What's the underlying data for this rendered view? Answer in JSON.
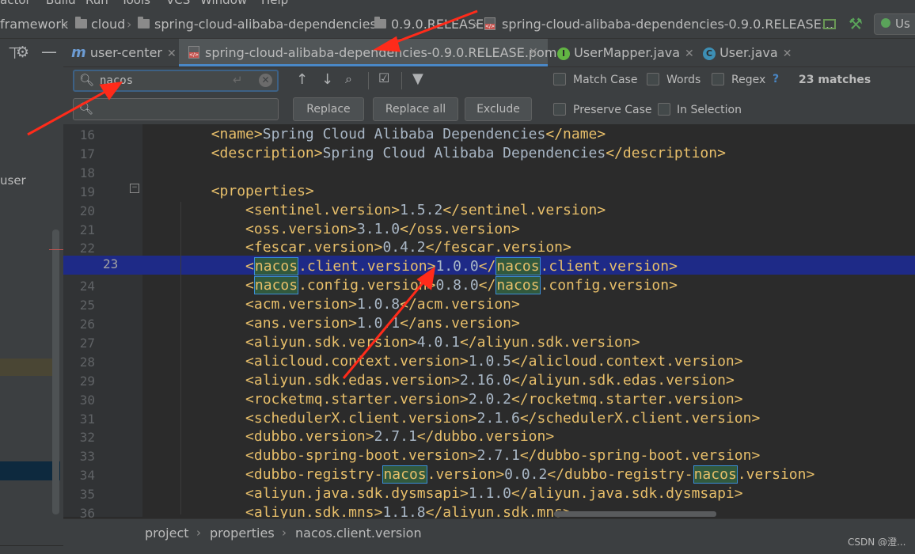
{
  "menubar": {
    "items": [
      "actor",
      "Build",
      "Run",
      "Tools",
      "VCS",
      "Window",
      "Help"
    ]
  },
  "navbar": {
    "crumbs": [
      "framework",
      "cloud",
      "spring-cloud-alibaba-dependencies",
      "0.9.0.RELEASE",
      "spring-cloud-alibaba-dependencies-0.9.0.RELEASE..."
    ],
    "user_button": "Us"
  },
  "left_panel": {
    "item": "user"
  },
  "tabs": [
    {
      "label": "user-center",
      "icon": "m"
    },
    {
      "label": "spring-cloud-alibaba-dependencies-0.9.0.RELEASE.pom",
      "icon": "pom"
    },
    {
      "label": "UserMapper.java",
      "icon": "I"
    },
    {
      "label": "User.java",
      "icon": "C"
    }
  ],
  "find": {
    "search_value": "nacos",
    "replace_value": "",
    "replace_button": "Replace",
    "replace_all_button": "Replace all",
    "exclude_button": "Exclude",
    "match_case": "Match Case",
    "words": "Words",
    "regex": "Regex",
    "help": "?",
    "matches": "23 matches",
    "preserve_case": "Preserve Case",
    "in_selection": "In Selection"
  },
  "code": {
    "lines": [
      {
        "num": "16",
        "indent": "        ",
        "parts": [
          [
            "t",
            "<name>"
          ],
          [
            "x",
            "Spring Cloud Alibaba Dependencies"
          ],
          [
            "t",
            "</name>"
          ]
        ]
      },
      {
        "num": "17",
        "indent": "        ",
        "parts": [
          [
            "t",
            "<description>"
          ],
          [
            "x",
            "Spring Cloud Alibaba Dependencies"
          ],
          [
            "t",
            "</description>"
          ]
        ]
      },
      {
        "num": "18",
        "indent": "",
        "parts": []
      },
      {
        "num": "19",
        "indent": "        ",
        "parts": [
          [
            "t",
            "<properties>"
          ]
        ]
      },
      {
        "num": "20",
        "indent": "            ",
        "parts": [
          [
            "t",
            "<sentinel.version>"
          ],
          [
            "x",
            "1.5.2"
          ],
          [
            "t",
            "</sentinel.version>"
          ]
        ]
      },
      {
        "num": "21",
        "indent": "            ",
        "parts": [
          [
            "t",
            "<oss.version>"
          ],
          [
            "x",
            "3.1.0"
          ],
          [
            "t",
            "</oss.version>"
          ]
        ]
      },
      {
        "num": "22",
        "indent": "            ",
        "parts": [
          [
            "t",
            "<fescar.version>"
          ],
          [
            "x",
            "0.4.2"
          ],
          [
            "t",
            "</fescar.version>"
          ]
        ]
      },
      {
        "num": "23",
        "indent": "            ",
        "parts": [
          [
            "t",
            "<"
          ],
          [
            "h",
            "nacos"
          ],
          [
            "t",
            ".client.version>"
          ],
          [
            "x",
            "1.0.0"
          ],
          [
            "t",
            "</"
          ],
          [
            "h",
            "nacos"
          ],
          [
            "t",
            ".client.version>"
          ]
        ]
      },
      {
        "num": "24",
        "indent": "            ",
        "parts": [
          [
            "t",
            "<"
          ],
          [
            "h",
            "nacos"
          ],
          [
            "t",
            ".config.version>"
          ],
          [
            "x",
            "0.8.0"
          ],
          [
            "t",
            "</"
          ],
          [
            "h",
            "nacos"
          ],
          [
            "t",
            ".config.version>"
          ]
        ]
      },
      {
        "num": "25",
        "indent": "            ",
        "parts": [
          [
            "t",
            "<acm.version>"
          ],
          [
            "x",
            "1.0.8"
          ],
          [
            "t",
            "</acm.version>"
          ]
        ]
      },
      {
        "num": "26",
        "indent": "            ",
        "parts": [
          [
            "t",
            "<ans.version>"
          ],
          [
            "x",
            "1.0.1"
          ],
          [
            "t",
            "</ans.version>"
          ]
        ]
      },
      {
        "num": "27",
        "indent": "            ",
        "parts": [
          [
            "t",
            "<aliyun.sdk.version>"
          ],
          [
            "x",
            "4.0.1"
          ],
          [
            "t",
            "</aliyun.sdk.version>"
          ]
        ]
      },
      {
        "num": "28",
        "indent": "            ",
        "parts": [
          [
            "t",
            "<alicloud.context.version>"
          ],
          [
            "x",
            "1.0.5"
          ],
          [
            "t",
            "</alicloud.context.version>"
          ]
        ]
      },
      {
        "num": "29",
        "indent": "            ",
        "parts": [
          [
            "t",
            "<aliyun.sdk.edas.version>"
          ],
          [
            "x",
            "2.16.0"
          ],
          [
            "t",
            "</aliyun.sdk.edas.version>"
          ]
        ]
      },
      {
        "num": "30",
        "indent": "            ",
        "parts": [
          [
            "t",
            "<rocketmq.starter.version>"
          ],
          [
            "x",
            "2.0.2"
          ],
          [
            "t",
            "</rocketmq.starter.version>"
          ]
        ]
      },
      {
        "num": "31",
        "indent": "            ",
        "parts": [
          [
            "t",
            "<schedulerX.client.version>"
          ],
          [
            "x",
            "2.1.6"
          ],
          [
            "t",
            "</schedulerX.client.version>"
          ]
        ]
      },
      {
        "num": "32",
        "indent": "            ",
        "parts": [
          [
            "t",
            "<dubbo.version>"
          ],
          [
            "x",
            "2.7.1"
          ],
          [
            "t",
            "</dubbo.version>"
          ]
        ]
      },
      {
        "num": "33",
        "indent": "            ",
        "parts": [
          [
            "t",
            "<dubbo-spring-boot.version>"
          ],
          [
            "x",
            "2.7.1"
          ],
          [
            "t",
            "</dubbo-spring-boot.version>"
          ]
        ]
      },
      {
        "num": "34",
        "indent": "            ",
        "parts": [
          [
            "t",
            "<dubbo-registry-"
          ],
          [
            "h",
            "nacos"
          ],
          [
            "t",
            ".version>"
          ],
          [
            "x",
            "0.0.2"
          ],
          [
            "t",
            "</dubbo-registry-"
          ],
          [
            "h",
            "nacos"
          ],
          [
            "t",
            ".version>"
          ]
        ]
      },
      {
        "num": "35",
        "indent": "            ",
        "parts": [
          [
            "t",
            "<aliyun.java.sdk.dysmsapi>"
          ],
          [
            "x",
            "1.1.0"
          ],
          [
            "t",
            "</aliyun.java.sdk.dysmsapi>"
          ]
        ]
      },
      {
        "num": "36",
        "indent": "            ",
        "parts": [
          [
            "t",
            "<aliyun.sdk.mns>"
          ],
          [
            "x",
            "1.1.8"
          ],
          [
            "t",
            "</aliyun.sdk.mns>"
          ]
        ]
      }
    ],
    "current_line": "23"
  },
  "breadcrumb": [
    "project",
    "properties",
    "nacos.client.version"
  ],
  "watermark": "CSDN @澄...",
  "colors": {
    "tag": "#e8bf6a",
    "text": "#a9b7c6",
    "current_line": "#1e2a8c",
    "match_border": "#3a8fd8",
    "arrow": "#ff2b1a"
  }
}
